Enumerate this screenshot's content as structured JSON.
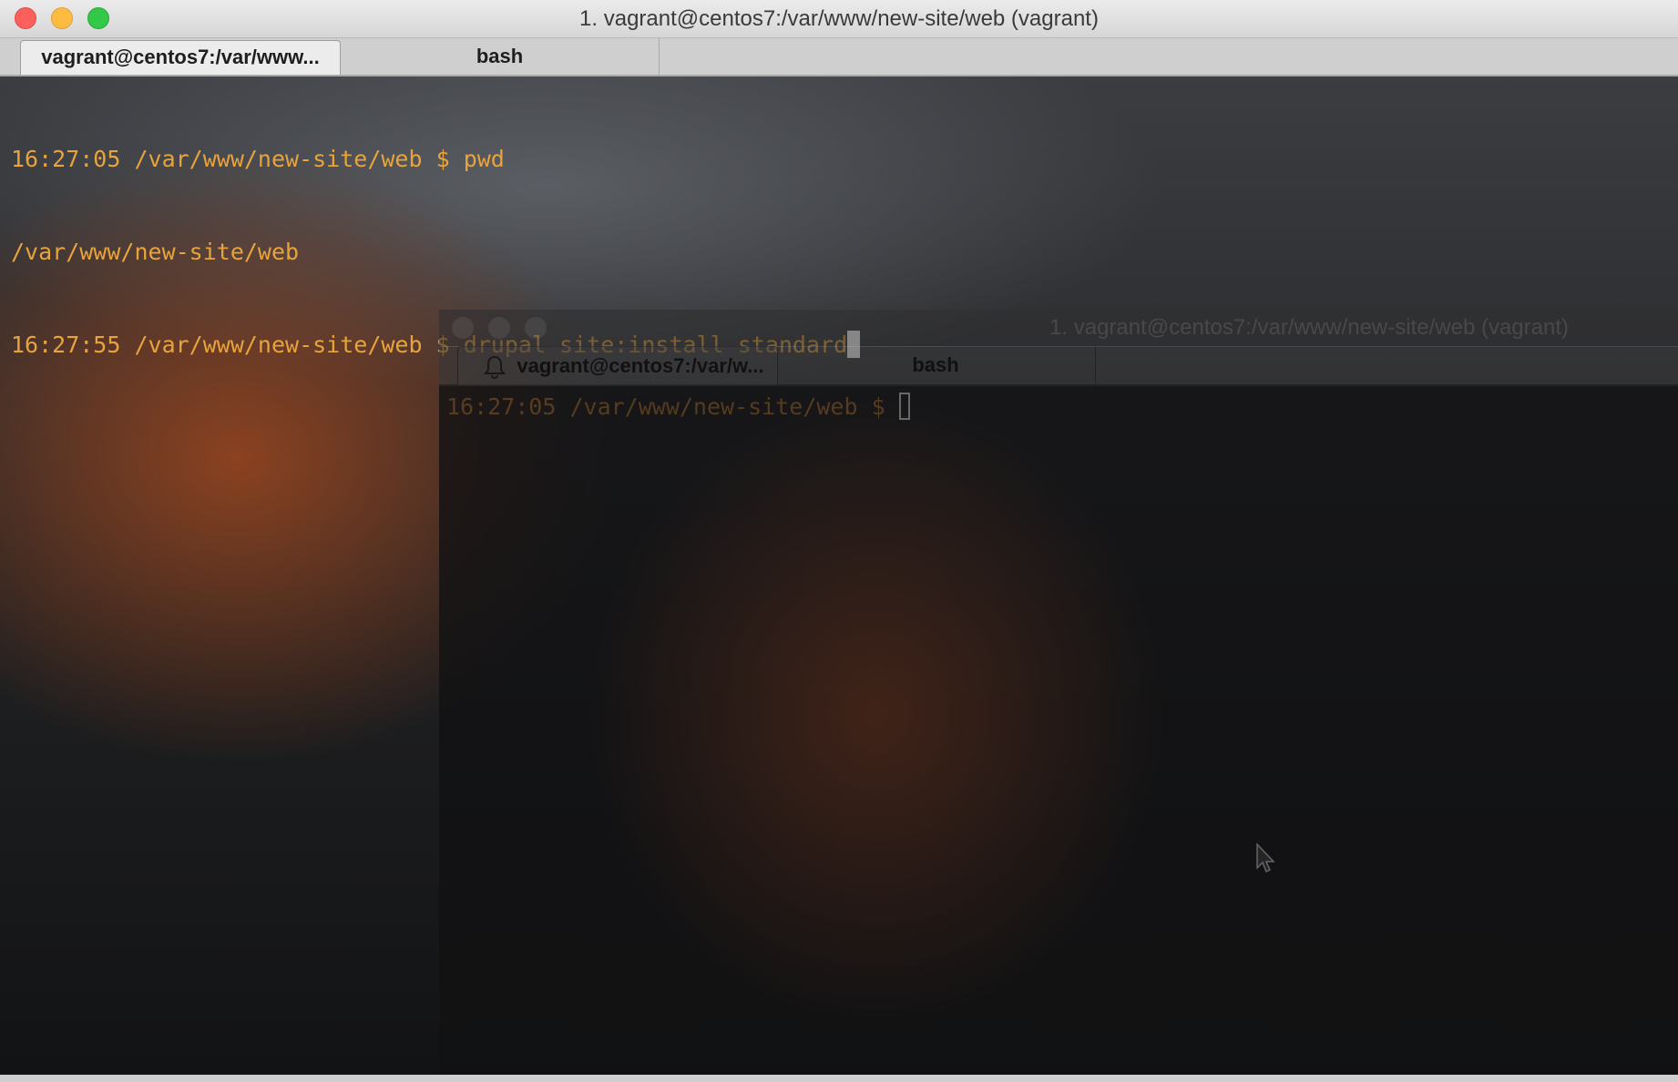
{
  "window": {
    "title": "1. vagrant@centos7:/var/www/new-site/web (vagrant)",
    "tabs": [
      {
        "label": "vagrant@centos7:/var/www...",
        "active": true
      },
      {
        "label": "bash",
        "active": false
      }
    ]
  },
  "terminal": {
    "lines": [
      "16:27:05 /var/www/new-site/web $ pwd",
      "/var/www/new-site/web",
      "16:27:55 /var/www/new-site/web $ drupal site:install standard"
    ],
    "text_color": "#e8a33d"
  },
  "second_window": {
    "title": "1. vagrant@centos7:/var/www/new-site/web (vagrant)",
    "tabs": [
      {
        "label": "vagrant@centos7:/var/w...",
        "active": true,
        "icon": "bell-icon"
      },
      {
        "label": "bash",
        "active": false
      }
    ],
    "prompt": "16:27:05 /var/www/new-site/web $ "
  }
}
